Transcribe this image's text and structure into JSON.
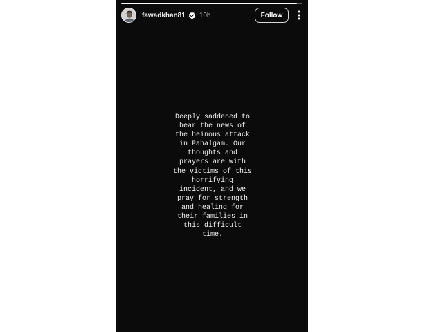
{
  "story": {
    "progress": 0.97,
    "header": {
      "username": "fawadkhan81",
      "verified_icon": "verified-badge-icon",
      "time_ago": "10h",
      "follow_label": "Follow",
      "more_icon": "more-vertical-icon"
    },
    "text": "Deeply saddened to\nhear the news of\nthe heinous attack\nin Pahalgam. Our\nthoughts and\nprayers are with\nthe victims of this\nhorrifying\nincident, and we\npray for strength\nand healing for\ntheir families in\nthis difficult\ntime."
  },
  "colors": {
    "story_background": "#0b0b0b",
    "text": "#f1f1f1",
    "verified_badge": "#ffffff"
  }
}
